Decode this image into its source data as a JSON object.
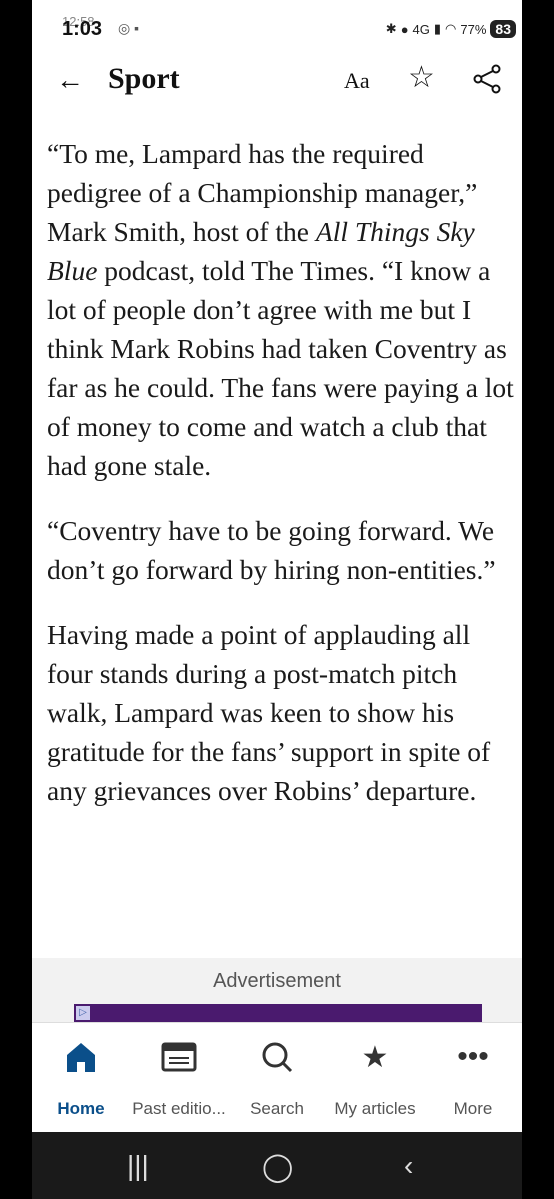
{
  "status": {
    "time": "1:03",
    "time_ghost": "12:58",
    "network": "4G",
    "battery_text": "77%",
    "battery_level": "83"
  },
  "topbar": {
    "section": "Sport",
    "font_label": "Aa",
    "icons": [
      "back-arrow-icon",
      "star-icon",
      "share-icon"
    ]
  },
  "article": {
    "p1_open": "“To me, Lampard has the required pedigree of a Championship manager,” Mark Smith, host of the ",
    "p1_italic": "All Things Sky Blue",
    "p1_close": " podcast, told The Times. “I know a lot of people don’t agree with me but I think Mark Robins had taken Coventry as far as he could. The fans were paying a lot of money to come and watch a club that had gone stale.",
    "p2": "“Coventry have to be going forward. We don’t go forward by hiring non-entities.”",
    "p3": "Having made a point of applauding all four stands during a post-match pitch walk, Lampard was keen to show his gratitude for the fans’ support in spite of any grievances over Robins’ departure."
  },
  "ad": {
    "label": "Advertisement"
  },
  "nav": {
    "items": [
      {
        "label": "Home",
        "icon": "home-icon",
        "active": true
      },
      {
        "label": "Past editio...",
        "icon": "newspaper-icon",
        "active": false
      },
      {
        "label": "Search",
        "icon": "search-icon",
        "active": false
      },
      {
        "label": "My articles",
        "icon": "star-icon",
        "active": false
      },
      {
        "label": "More",
        "icon": "more-icon",
        "active": false
      }
    ]
  },
  "colors": {
    "accent": "#0b4f8a",
    "text": "#1a1a1a"
  }
}
